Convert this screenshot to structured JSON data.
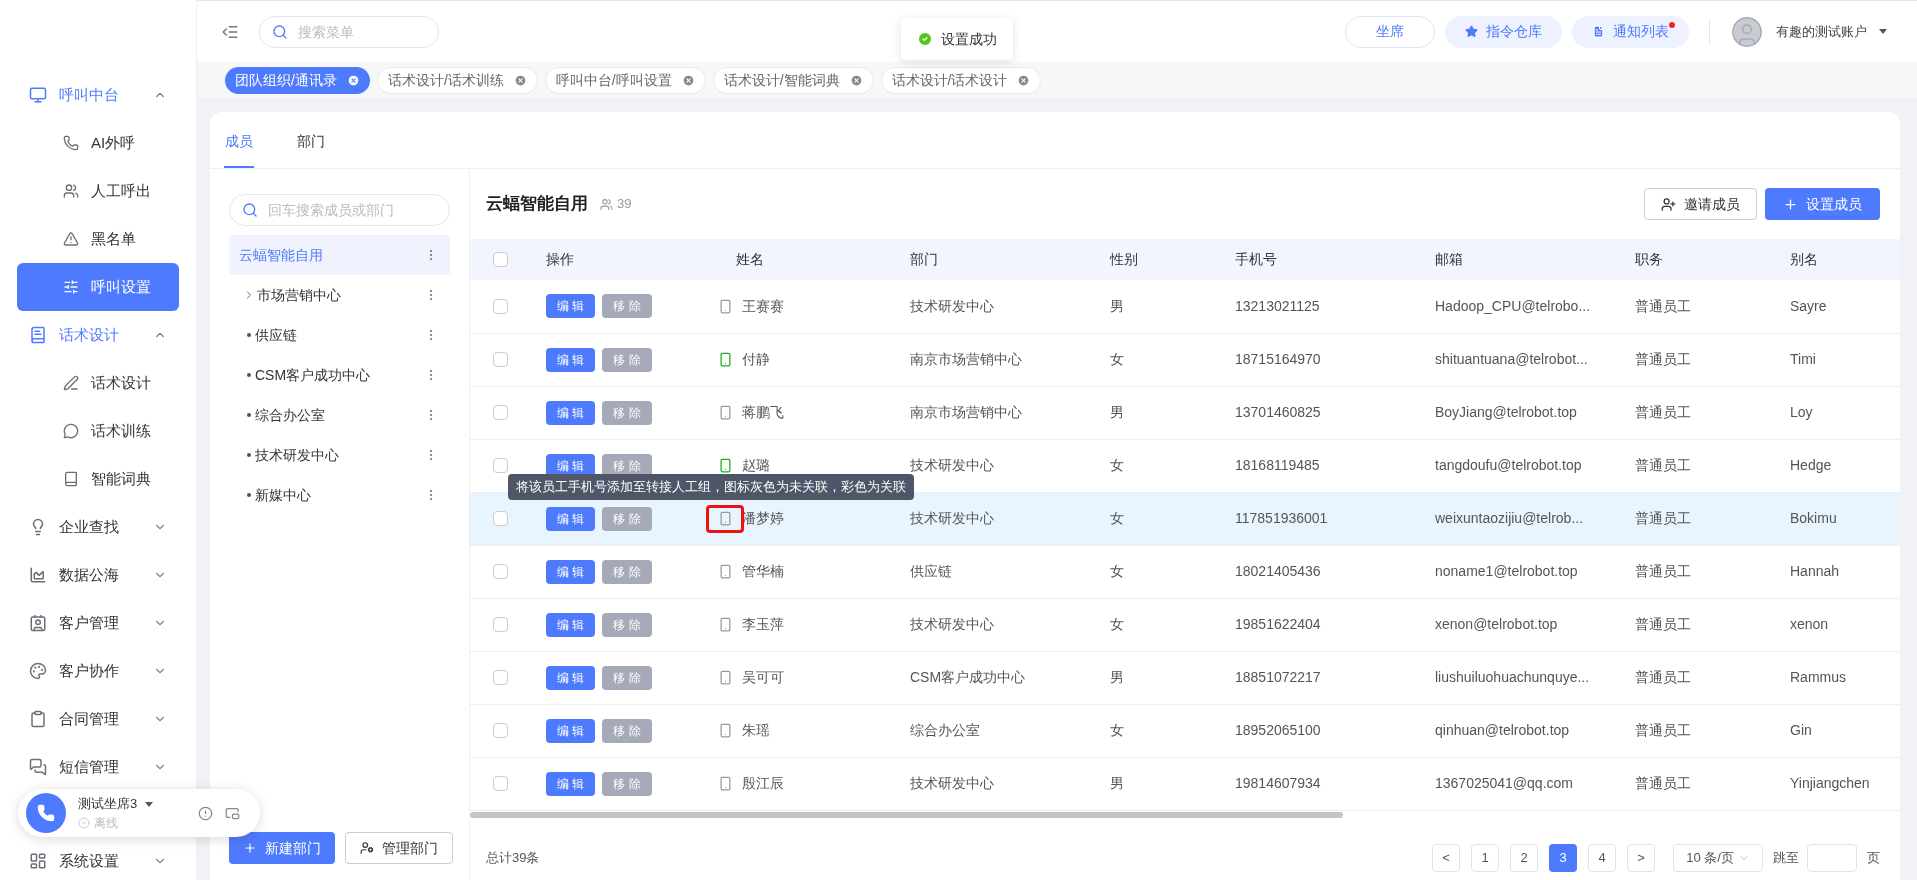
{
  "sidebar": {
    "items": [
      {
        "label": "呼叫中台",
        "expanded": true,
        "selected": false,
        "children": [
          {
            "label": "AI外呼",
            "selected": false
          },
          {
            "label": "人工呼出",
            "selected": false
          },
          {
            "label": "黑名单",
            "selected": false
          },
          {
            "label": "呼叫设置",
            "selected": true
          }
        ]
      },
      {
        "label": "话术设计",
        "expanded": true,
        "selected": false,
        "children": [
          {
            "label": "话术设计",
            "selected": false
          },
          {
            "label": "话术训练",
            "selected": false
          },
          {
            "label": "智能词典",
            "selected": false
          }
        ]
      },
      {
        "label": "企业查找",
        "expanded": false,
        "selected": false
      },
      {
        "label": "数据公海",
        "expanded": false,
        "selected": false
      },
      {
        "label": "客户管理",
        "expanded": false,
        "selected": false
      },
      {
        "label": "客户协作",
        "expanded": false,
        "selected": false
      },
      {
        "label": "合同管理",
        "expanded": false,
        "selected": false
      },
      {
        "label": "短信管理",
        "expanded": false,
        "selected": false
      },
      {
        "label": "系统设置",
        "expanded": false,
        "selected": false
      }
    ]
  },
  "seat_widget": {
    "name": "测试坐席3",
    "status": "离线"
  },
  "header": {
    "search": {
      "placeholder": "搜索菜单"
    },
    "buttons": [
      {
        "label": "坐席",
        "kind": "outline",
        "badge": false
      },
      {
        "label": "指令仓库",
        "kind": "soft",
        "badge": false
      },
      {
        "label": "通知列表",
        "kind": "soft",
        "badge": true
      }
    ],
    "user": "有趣的测试账户"
  },
  "toast": {
    "text": "设置成功"
  },
  "page_tabs": [
    {
      "label": "团队组织/通讯录",
      "selected": true
    },
    {
      "label": "话术设计/话术训练",
      "selected": false
    },
    {
      "label": "呼叫中台/呼叫设置",
      "selected": false
    },
    {
      "label": "话术设计/智能词典",
      "selected": false
    },
    {
      "label": "话术设计/话术设计",
      "selected": false
    }
  ],
  "card_tabs": [
    {
      "label": "成员",
      "selected": true
    },
    {
      "label": "部门",
      "selected": false
    }
  ],
  "departments": {
    "search": {
      "placeholder": "回车搜索成员或部门"
    },
    "tree": [
      {
        "label": "云蝠智能自用",
        "selected": true,
        "children": [
          {
            "label": "市场营销中心",
            "selected": false,
            "expandable": true
          },
          {
            "label": "供应链",
            "selected": false,
            "expandable": false
          },
          {
            "label": "CSM客户成功中心",
            "selected": false,
            "expandable": false
          },
          {
            "label": "综合办公室",
            "selected": false,
            "expandable": false
          },
          {
            "label": "技术研发中心",
            "selected": false,
            "expandable": false
          },
          {
            "label": "新媒中心",
            "selected": false,
            "expandable": false
          }
        ]
      }
    ],
    "buttons": [
      {
        "label": "新建部门",
        "kind": "primary"
      },
      {
        "label": "管理部门",
        "kind": "outline"
      }
    ]
  },
  "members": {
    "title": "云蝠智能自用",
    "count": "39",
    "buttons": [
      {
        "label": "邀请成员",
        "kind": "outline"
      },
      {
        "label": "设置成员",
        "kind": "primary"
      }
    ],
    "columns": [
      "操作",
      "姓名",
      "部门",
      "性别",
      "手机号",
      "邮箱",
      "职务",
      "别名"
    ],
    "all_checked": false,
    "tooltip": "将该员工手机号添加至转接人工组，图标灰色为未关联，彩色为关联",
    "rows": [
      {
        "checked": false,
        "hovered": false,
        "linked": false,
        "highlighted": false,
        "edit": "编 辑",
        "remove": "移 除",
        "name": "王赛赛",
        "dept": "技术研发中心",
        "gender": "男",
        "phone": "13213021125",
        "email": "Hadoop_CPU@telrobo...",
        "role": "普通员工",
        "alias": "Sayre"
      },
      {
        "checked": false,
        "hovered": false,
        "linked": true,
        "highlighted": false,
        "edit": "编 辑",
        "remove": "移 除",
        "name": "付静",
        "dept": "南京市场营销中心",
        "gender": "女",
        "phone": "18715164970",
        "email": "shituantuana@telrobot...",
        "role": "普通员工",
        "alias": "Timi"
      },
      {
        "checked": false,
        "hovered": false,
        "linked": false,
        "highlighted": false,
        "edit": "编 辑",
        "remove": "移 除",
        "name": "蒋鹏飞",
        "dept": "南京市场营销中心",
        "gender": "男",
        "phone": "13701460825",
        "email": "BoyJiang@telrobot.top",
        "role": "普通员工",
        "alias": "Loy"
      },
      {
        "checked": false,
        "hovered": false,
        "linked": true,
        "highlighted": false,
        "edit": "编 辑",
        "remove": "移 除",
        "name": "赵璐",
        "dept": "技术研发中心",
        "gender": "女",
        "phone": "18168119485",
        "email": "tangdoufu@telrobot.top",
        "role": "普通员工",
        "alias": "Hedge"
      },
      {
        "checked": false,
        "hovered": true,
        "linked": false,
        "highlighted": true,
        "edit": "编 辑",
        "remove": "移 除",
        "name": "潘梦婷",
        "dept": "技术研发中心",
        "gender": "女",
        "phone": "117851936001",
        "email": "weixuntaozijiu@telrob...",
        "role": "普通员工",
        "alias": "Bokimu"
      },
      {
        "checked": false,
        "hovered": false,
        "linked": false,
        "highlighted": false,
        "edit": "编 辑",
        "remove": "移 除",
        "name": "管华楠",
        "dept": "供应链",
        "gender": "女",
        "phone": "18021405436",
        "email": "noname1@telrobot.top",
        "role": "普通员工",
        "alias": "Hannah"
      },
      {
        "checked": false,
        "hovered": false,
        "linked": false,
        "highlighted": false,
        "edit": "编 辑",
        "remove": "移 除",
        "name": "李玉萍",
        "dept": "技术研发中心",
        "gender": "女",
        "phone": "19851622404",
        "email": "xenon@telrobot.top",
        "role": "普通员工",
        "alias": "xenon"
      },
      {
        "checked": false,
        "hovered": false,
        "linked": false,
        "highlighted": false,
        "edit": "编 辑",
        "remove": "移 除",
        "name": "吴可可",
        "dept": "CSM客户成功中心",
        "gender": "男",
        "phone": "18851072217",
        "email": "liushuiluohuachunquye...",
        "role": "普通员工",
        "alias": "Rammus"
      },
      {
        "checked": false,
        "hovered": false,
        "linked": false,
        "highlighted": false,
        "edit": "编 辑",
        "remove": "移 除",
        "name": "朱瑶",
        "dept": "综合办公室",
        "gender": "女",
        "phone": "18952065100",
        "email": "qinhuan@telrobot.top",
        "role": "普通员工",
        "alias": "Gin"
      },
      {
        "checked": false,
        "hovered": false,
        "linked": false,
        "highlighted": false,
        "edit": "编 辑",
        "remove": "移 除",
        "name": "殷江辰",
        "dept": "技术研发中心",
        "gender": "男",
        "phone": "19814607934",
        "email": "1367025041@qq.com",
        "role": "普通员工",
        "alias": "Yinjiangchen"
      }
    ],
    "total": "总计39条",
    "pagination": {
      "prev": "<",
      "next": ">",
      "pages": [
        {
          "label": "1",
          "selected": false
        },
        {
          "label": "2",
          "selected": false
        },
        {
          "label": "3",
          "selected": true
        },
        {
          "label": "4",
          "selected": false
        }
      ],
      "page_size": "10 条/页",
      "jump_label": "跳至",
      "jump_suffix": "页"
    }
  }
}
